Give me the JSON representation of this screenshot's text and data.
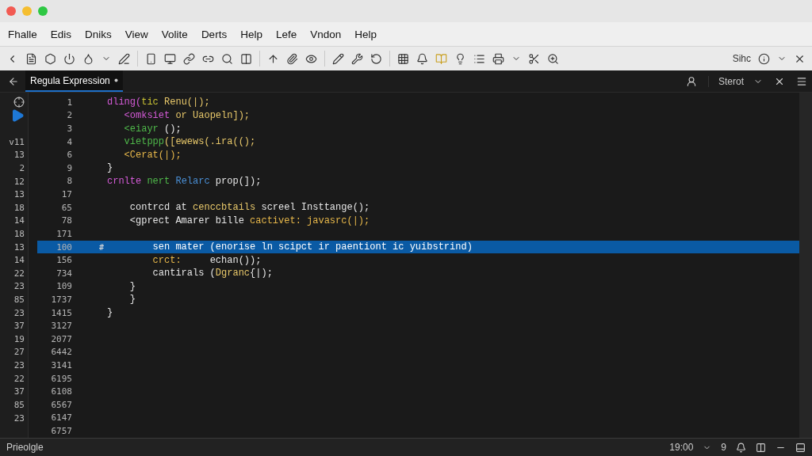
{
  "menu": [
    "Fhalle",
    "Edis",
    "Dniks",
    "View",
    "Volite",
    "Derts",
    "Help",
    "Lefe",
    "Vndon",
    "Help"
  ],
  "toolbar_right": {
    "label": "Sihc"
  },
  "tab": {
    "label": "Regula Expression",
    "selected": true
  },
  "panel_dropdown": {
    "label": "Sterot"
  },
  "rows": [
    {
      "kind": "target",
      "number": "1",
      "selected": false,
      "code": [
        {
          "text": "dling(",
          "color": "#d35ad6"
        },
        {
          "text": "tic ",
          "color": "#c9c234"
        },
        {
          "text": "Renu(|);",
          "color": "#e8c86a"
        }
      ]
    },
    {
      "kind": "run",
      "number": "2",
      "selected": false,
      "code": [
        {
          "text": "   <omksiet ",
          "color": "#d35ad6"
        },
        {
          "text": "or Uaopeln]);",
          "color": "#e8c86a"
        }
      ]
    },
    {
      "kind": "empty",
      "number": "3",
      "selected": false,
      "code": [
        {
          "text": "   <eiayr ",
          "color": "#4fb84a"
        },
        {
          "text": "();",
          "color": "#e6e6e6"
        }
      ]
    },
    {
      "kind": "number",
      "gutter": "v11",
      "number": "4",
      "selected": false,
      "code": [
        {
          "text": "   vietppp",
          "color": "#4fb84a"
        },
        {
          "text": "([ewews(.ira(();",
          "color": "#e8c86a"
        }
      ]
    },
    {
      "kind": "number",
      "gutter": "13",
      "number": "6",
      "selected": false,
      "code": [
        {
          "text": "   <Cerat(|);",
          "color": "#e8b84a"
        }
      ]
    },
    {
      "kind": "number",
      "gutter": "2",
      "number": "9",
      "selected": false,
      "code": [
        {
          "text": "}",
          "color": "#e6e6e6"
        }
      ]
    },
    {
      "kind": "number",
      "gutter": "12",
      "number": "8",
      "selected": false,
      "code": [
        {
          "text": "crnlte ",
          "color": "#d35ad6"
        },
        {
          "text": "nert ",
          "color": "#4fb84a"
        },
        {
          "text": "Relarc ",
          "color": "#4a8fd6"
        },
        {
          "text": "prop(]);",
          "color": "#e6e6e6"
        }
      ]
    },
    {
      "kind": "number",
      "gutter": "13",
      "number": "17",
      "selected": false,
      "code": []
    },
    {
      "kind": "number",
      "gutter": "18",
      "number": "65",
      "selected": false,
      "code": [
        {
          "text": "    contrcd at ",
          "color": "#e6e6e6"
        },
        {
          "text": "cenccbtails ",
          "color": "#e8c86a"
        },
        {
          "text": "screel Insttange();",
          "color": "#e6e6e6"
        }
      ]
    },
    {
      "kind": "number",
      "gutter": "14",
      "number": "78",
      "selected": false,
      "code": [
        {
          "text": "    <gprect Amarer bille ",
          "color": "#e6e6e6"
        },
        {
          "text": "cactivet: javasrc(|);",
          "color": "#e8b84a"
        }
      ]
    },
    {
      "kind": "number",
      "gutter": "18",
      "number": "171",
      "selected": false,
      "code": []
    },
    {
      "kind": "number",
      "gutter": "13",
      "number": "100",
      "selected": true,
      "marker": "#",
      "code": [
        {
          "text": "        sen mater (enorise ln scipct ir paentiont ic yuibstrind)"
        }
      ]
    },
    {
      "kind": "number",
      "gutter": "14",
      "number": "156",
      "selected": false,
      "code": [
        {
          "text": "        crct:",
          "color": "#e8b84a"
        },
        {
          "text": "     echan());",
          "color": "#e6e6e6"
        }
      ]
    },
    {
      "kind": "number",
      "gutter": "22",
      "number": "734",
      "selected": false,
      "code": [
        {
          "text": "        cantirals (",
          "color": "#e6e6e6"
        },
        {
          "text": "Dgranc",
          "color": "#e8c86a"
        },
        {
          "text": "{|);",
          "color": "#e6e6e6"
        }
      ]
    },
    {
      "kind": "number",
      "gutter": "23",
      "number": "109",
      "selected": false,
      "code": [
        {
          "text": "    }",
          "color": "#e6e6e6"
        }
      ]
    },
    {
      "kind": "number",
      "gutter": "85",
      "number": "1737",
      "selected": false,
      "code": [
        {
          "text": "    }",
          "color": "#e6e6e6"
        }
      ]
    },
    {
      "kind": "number",
      "gutter": "23",
      "number": "1415",
      "selected": false,
      "code": [
        {
          "text": "}",
          "color": "#e6e6e6"
        }
      ]
    },
    {
      "kind": "number",
      "gutter": "37",
      "number": "3127",
      "selected": false,
      "code": []
    },
    {
      "kind": "number",
      "gutter": "19",
      "number": "2077",
      "selected": false,
      "code": []
    },
    {
      "kind": "number",
      "gutter": "27",
      "number": "6442",
      "selected": false,
      "code": []
    },
    {
      "kind": "number",
      "gutter": "23",
      "number": "3141",
      "selected": false,
      "code": []
    },
    {
      "kind": "number",
      "gutter": "22",
      "number": "6195",
      "selected": false,
      "code": []
    },
    {
      "kind": "number",
      "gutter": "37",
      "number": "6108",
      "selected": false,
      "code": []
    },
    {
      "kind": "number",
      "gutter": "85",
      "number": "6567",
      "selected": false,
      "code": []
    },
    {
      "kind": "number",
      "gutter": "23",
      "number": "6147",
      "selected": false,
      "code": []
    },
    {
      "kind": "empty",
      "number": "6757",
      "selected": false,
      "code": []
    }
  ],
  "status": {
    "left": "Prieolgle",
    "position": "19:00",
    "column": "9"
  }
}
